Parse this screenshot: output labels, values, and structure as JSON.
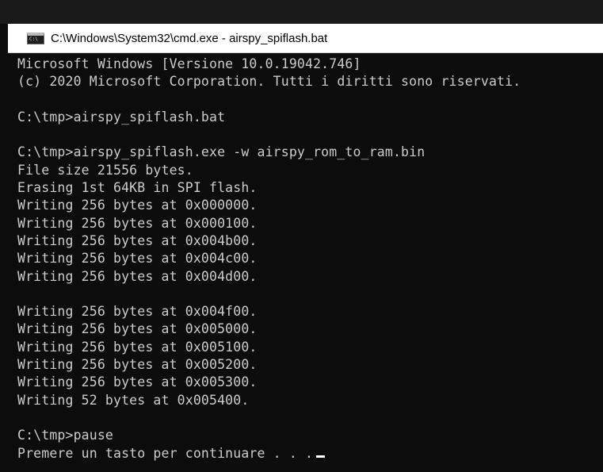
{
  "window": {
    "title": "C:\\Windows\\System32\\cmd.exe - airspy_spiflash.bat",
    "icon": "cmd-console-icon",
    "icon_text": "C:\\"
  },
  "console": {
    "lines": [
      "Microsoft Windows [Versione 10.0.19042.746]",
      "(c) 2020 Microsoft Corporation. Tutti i diritti sono riservati.",
      "",
      "C:\\tmp>airspy_spiflash.bat",
      "",
      "C:\\tmp>airspy_spiflash.exe -w airspy_rom_to_ram.bin",
      "File size 21556 bytes.",
      "Erasing 1st 64KB in SPI flash.",
      "Writing 256 bytes at 0x000000.",
      "Writing 256 bytes at 0x000100.",
      "Writing 256 bytes at 0x004b00.",
      "Writing 256 bytes at 0x004c00.",
      "Writing 256 bytes at 0x004d00.",
      "",
      "Writing 256 bytes at 0x004f00.",
      "Writing 256 bytes at 0x005000.",
      "Writing 256 bytes at 0x005100.",
      "Writing 256 bytes at 0x005200.",
      "Writing 256 bytes at 0x005300.",
      "Writing 52 bytes at 0x005400.",
      "",
      "C:\\tmp>pause",
      "Premere un tasto per continuare . . ."
    ]
  },
  "colors": {
    "console_background": "#0c0c0c",
    "console_text": "#cccccc",
    "titlebar_background": "#ffffff"
  }
}
